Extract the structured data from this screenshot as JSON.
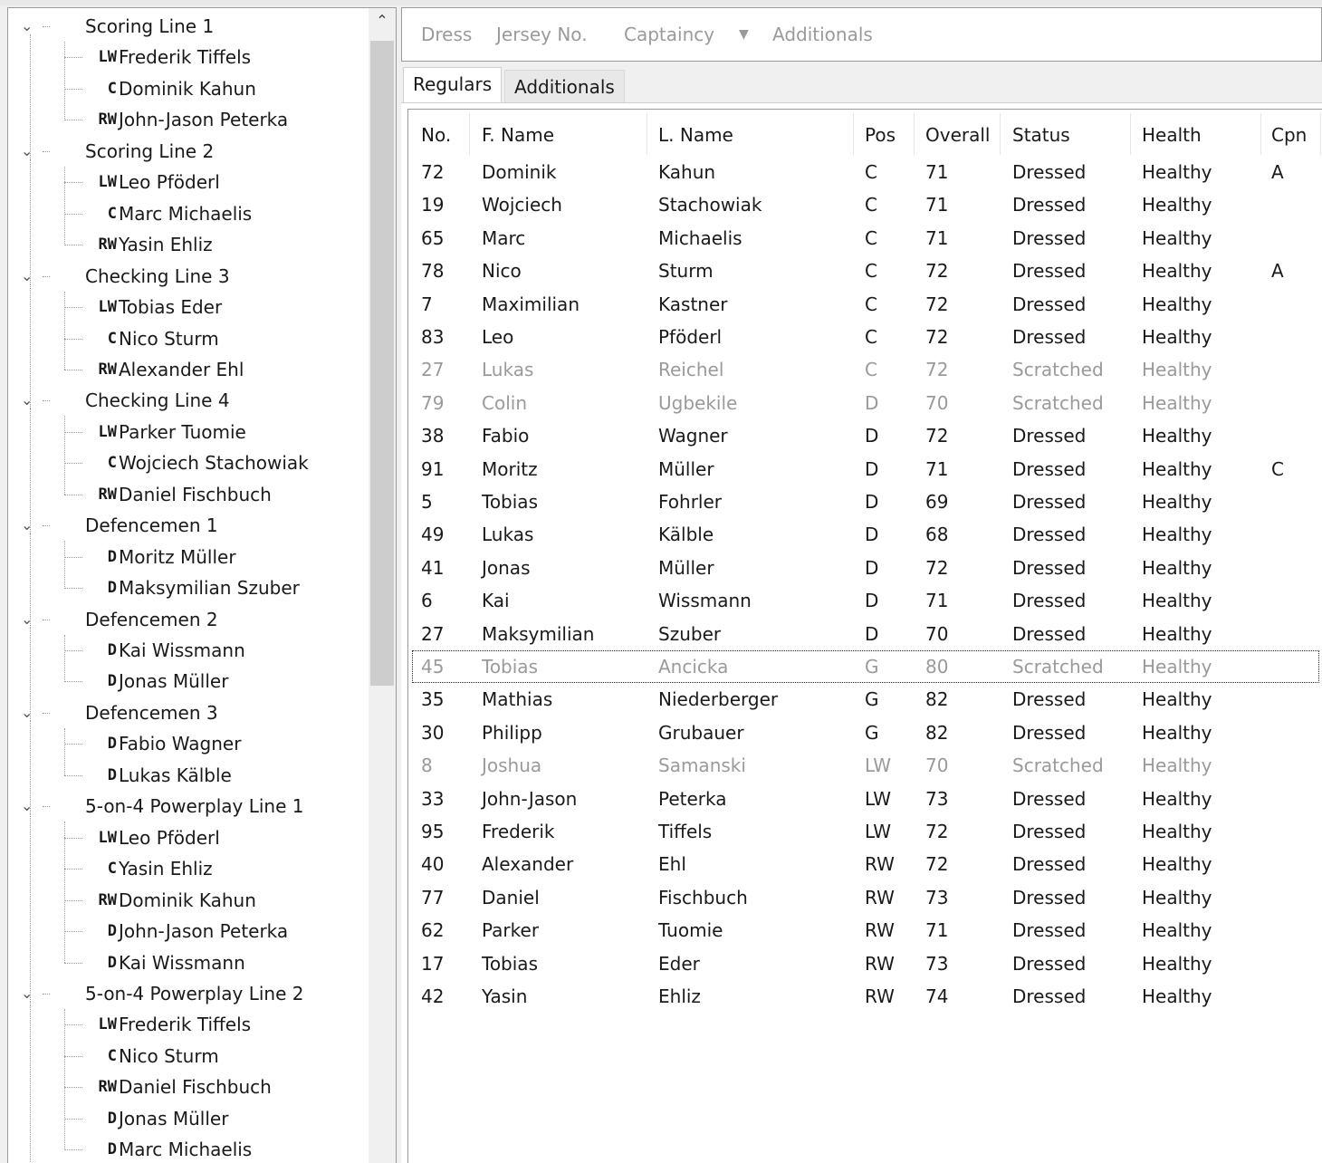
{
  "tree": [
    {
      "group": "Scoring Line 1",
      "players": [
        [
          "LW",
          "Frederik Tiffels"
        ],
        [
          "C",
          "Dominik Kahun"
        ],
        [
          "RW",
          "John-Jason Peterka"
        ]
      ]
    },
    {
      "group": "Scoring Line 2",
      "players": [
        [
          "LW",
          "Leo Pföderl"
        ],
        [
          "C",
          "Marc Michaelis"
        ],
        [
          "RW",
          "Yasin Ehliz"
        ]
      ]
    },
    {
      "group": "Checking Line 3",
      "players": [
        [
          "LW",
          "Tobias Eder"
        ],
        [
          "C",
          "Nico Sturm"
        ],
        [
          "RW",
          "Alexander Ehl"
        ]
      ]
    },
    {
      "group": "Checking Line 4",
      "players": [
        [
          "LW",
          "Parker Tuomie"
        ],
        [
          "C",
          "Wojciech Stachowiak"
        ],
        [
          "RW",
          "Daniel Fischbuch"
        ]
      ]
    },
    {
      "group": "Defencemen 1",
      "players": [
        [
          "D",
          "Moritz Müller"
        ],
        [
          "D",
          "Maksymilian Szuber"
        ]
      ]
    },
    {
      "group": "Defencemen 2",
      "players": [
        [
          "D",
          "Kai Wissmann"
        ],
        [
          "D",
          "Jonas Müller"
        ]
      ]
    },
    {
      "group": "Defencemen 3",
      "players": [
        [
          "D",
          "Fabio Wagner"
        ],
        [
          "D",
          "Lukas Kälble"
        ]
      ]
    },
    {
      "group": "5-on-4 Powerplay Line 1",
      "players": [
        [
          "LW",
          "Leo Pföderl"
        ],
        [
          "C",
          "Yasin Ehliz"
        ],
        [
          "RW",
          "Dominik Kahun"
        ],
        [
          "D",
          "John-Jason Peterka"
        ],
        [
          "D",
          "Kai Wissmann"
        ]
      ]
    },
    {
      "group": "5-on-4 Powerplay Line 2",
      "players": [
        [
          "LW",
          "Frederik Tiffels"
        ],
        [
          "C",
          "Nico Sturm"
        ],
        [
          "RW",
          "Daniel Fischbuch"
        ],
        [
          "D",
          "Jonas Müller"
        ],
        [
          "D",
          "Marc Michaelis"
        ]
      ]
    }
  ],
  "toolbar": {
    "dress": "Dress",
    "jersey": "Jersey No.",
    "captaincy": "Captaincy",
    "additionals": "Additionals"
  },
  "tabs": {
    "regulars": "Regulars",
    "additionals": "Additionals"
  },
  "columns": [
    "No.",
    "F. Name",
    "L. Name",
    "Pos",
    "Overall",
    "Status",
    "Health",
    "Cpn"
  ],
  "rows": [
    [
      "72",
      "Dominik",
      "Kahun",
      "C",
      "71",
      "Dressed",
      "Healthy",
      "A"
    ],
    [
      "19",
      "Wojciech",
      "Stachowiak",
      "C",
      "71",
      "Dressed",
      "Healthy",
      ""
    ],
    [
      "65",
      "Marc",
      "Michaelis",
      "C",
      "71",
      "Dressed",
      "Healthy",
      ""
    ],
    [
      "78",
      "Nico",
      "Sturm",
      "C",
      "72",
      "Dressed",
      "Healthy",
      "A"
    ],
    [
      "7",
      "Maximilian",
      "Kastner",
      "C",
      "72",
      "Dressed",
      "Healthy",
      ""
    ],
    [
      "83",
      "Leo",
      "Pföderl",
      "C",
      "72",
      "Dressed",
      "Healthy",
      ""
    ],
    [
      "27",
      "Lukas",
      "Reichel",
      "C",
      "72",
      "Scratched",
      "Healthy",
      ""
    ],
    [
      "79",
      "Colin",
      "Ugbekile",
      "D",
      "70",
      "Scratched",
      "Healthy",
      ""
    ],
    [
      "38",
      "Fabio",
      "Wagner",
      "D",
      "72",
      "Dressed",
      "Healthy",
      ""
    ],
    [
      "91",
      "Moritz",
      "Müller",
      "D",
      "71",
      "Dressed",
      "Healthy",
      "C"
    ],
    [
      "5",
      "Tobias",
      "Fohrler",
      "D",
      "69",
      "Dressed",
      "Healthy",
      ""
    ],
    [
      "49",
      "Lukas",
      "Kälble",
      "D",
      "68",
      "Dressed",
      "Healthy",
      ""
    ],
    [
      "41",
      "Jonas",
      "Müller",
      "D",
      "72",
      "Dressed",
      "Healthy",
      ""
    ],
    [
      "6",
      "Kai",
      "Wissmann",
      "D",
      "71",
      "Dressed",
      "Healthy",
      ""
    ],
    [
      "27",
      "Maksymilian",
      "Szuber",
      "D",
      "70",
      "Dressed",
      "Healthy",
      ""
    ],
    [
      "45",
      "Tobias",
      "Ancicka",
      "G",
      "80",
      "Scratched",
      "Healthy",
      ""
    ],
    [
      "35",
      "Mathias",
      "Niederberger",
      "G",
      "82",
      "Dressed",
      "Healthy",
      ""
    ],
    [
      "30",
      "Philipp",
      "Grubauer",
      "G",
      "82",
      "Dressed",
      "Healthy",
      ""
    ],
    [
      "8",
      "Joshua",
      "Samanski",
      "LW",
      "70",
      "Scratched",
      "Healthy",
      ""
    ],
    [
      "33",
      "John-Jason",
      "Peterka",
      "LW",
      "73",
      "Dressed",
      "Healthy",
      ""
    ],
    [
      "95",
      "Frederik",
      "Tiffels",
      "LW",
      "72",
      "Dressed",
      "Healthy",
      ""
    ],
    [
      "40",
      "Alexander",
      "Ehl",
      "RW",
      "72",
      "Dressed",
      "Healthy",
      ""
    ],
    [
      "77",
      "Daniel",
      "Fischbuch",
      "RW",
      "73",
      "Dressed",
      "Healthy",
      ""
    ],
    [
      "62",
      "Parker",
      "Tuomie",
      "RW",
      "71",
      "Dressed",
      "Healthy",
      ""
    ],
    [
      "17",
      "Tobias",
      "Eder",
      "RW",
      "73",
      "Dressed",
      "Healthy",
      ""
    ],
    [
      "42",
      "Yasin",
      "Ehliz",
      "RW",
      "74",
      "Dressed",
      "Healthy",
      ""
    ]
  ]
}
